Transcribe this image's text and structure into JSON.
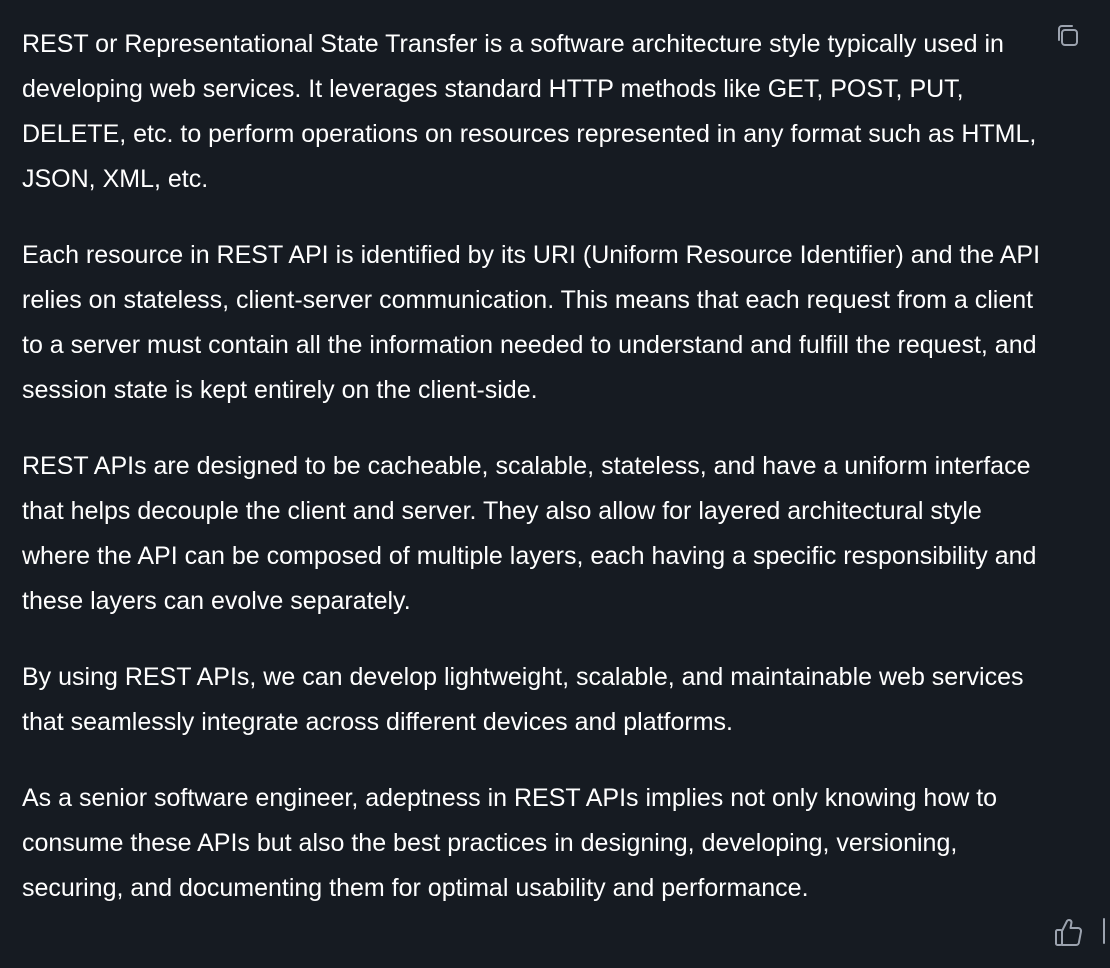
{
  "message": {
    "paragraphs": [
      "REST or Representational State Transfer is a software architecture style typically used in developing web services. It leverages standard HTTP methods like GET, POST, PUT, DELETE, etc. to perform operations on resources represented in any format such as HTML, JSON, XML, etc.",
      "Each resource in REST API is identified by its URI (Uniform Resource Identifier) and the API relies on stateless, client-server communication. This means that each request from a client to a server must contain all the information needed to understand and fulfill the request, and session state is kept entirely on the client-side.",
      "REST APIs are designed to be cacheable, scalable, stateless, and have a uniform interface that helps decouple the client and server. They also allow for layered architectural style where the API can be composed of multiple layers, each having a specific responsibility and these layers can evolve separately.",
      "By using REST APIs, we can develop lightweight, scalable, and maintainable web services that seamlessly integrate across different devices and platforms.",
      "As a senior software engineer, adeptness in REST APIs implies not only knowing how to consume these APIs but also the best practices in designing, developing, versioning, securing, and documenting them for optimal usability and performance."
    ]
  },
  "actions": {
    "copy_icon": "copy-icon",
    "thumbs_up_icon": "thumbs-up-icon",
    "thumbs_down_icon": "thumbs-down-icon"
  },
  "colors": {
    "background": "#161b22",
    "text": "#ffffff",
    "icon": "#9ca3af"
  }
}
